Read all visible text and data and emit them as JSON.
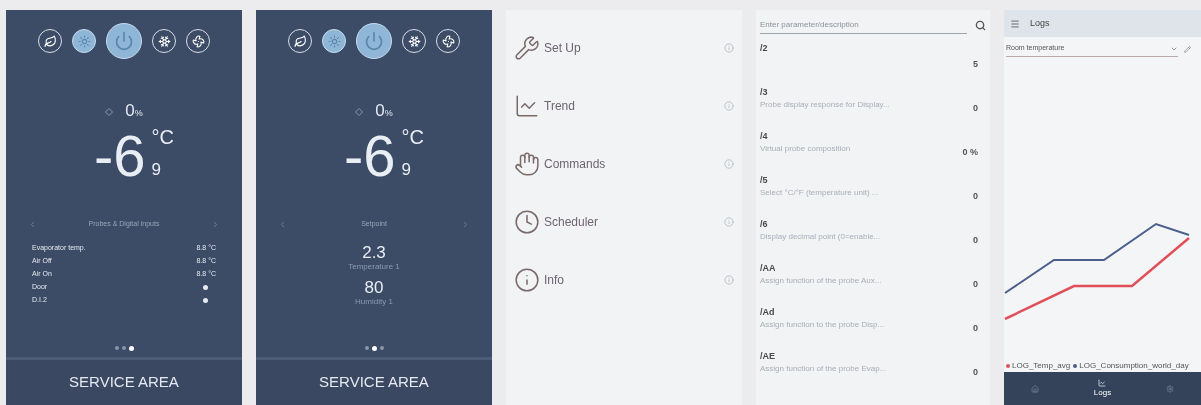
{
  "panels": [
    {
      "kind": "thermostat",
      "mode_icons": [
        {
          "kind": "leaf",
          "selected": false
        },
        {
          "kind": "light",
          "selected": true
        },
        {
          "kind": "power",
          "selected": true
        },
        {
          "kind": "defrost",
          "selected": false
        },
        {
          "kind": "fan",
          "selected": false
        }
      ],
      "humidity": {
        "value": "0",
        "unit": "%"
      },
      "temperature": {
        "value": "-6",
        "unit": "°C",
        "decimal": "9"
      },
      "section_title": "Probes & Digital inputs",
      "readings": [
        {
          "label": "Evaporator temp.",
          "value": "8.8 °C",
          "kind": "text"
        },
        {
          "label": "Air Off",
          "value": "8.8 °C",
          "kind": "text"
        },
        {
          "label": "Air On",
          "value": "8.8 °C",
          "kind": "text"
        },
        {
          "label": "Door",
          "kind": "dot"
        },
        {
          "label": "D.I.2",
          "kind": "dot"
        }
      ],
      "page_dots": [
        {
          "selected": false
        },
        {
          "selected": false
        },
        {
          "selected": true
        }
      ],
      "footer_button": "SERVICE AREA"
    },
    {
      "kind": "thermostat",
      "mode_icons": [
        {
          "kind": "leaf",
          "selected": false
        },
        {
          "kind": "light",
          "selected": true
        },
        {
          "kind": "power",
          "selected": true
        },
        {
          "kind": "defrost",
          "selected": false
        },
        {
          "kind": "fan",
          "selected": false
        }
      ],
      "humidity": {
        "value": "0",
        "unit": "%"
      },
      "temperature": {
        "value": "-6",
        "unit": "°C",
        "decimal": "9"
      },
      "section_title": "Setpoint",
      "setpoints": [
        {
          "value": "2.3",
          "caption": "Temperature 1"
        },
        {
          "value": "80",
          "caption": "Humidity 1"
        }
      ],
      "page_dots": [
        {
          "selected": false
        },
        {
          "selected": true
        },
        {
          "selected": false
        }
      ],
      "footer_button": "SERVICE AREA"
    },
    {
      "kind": "menu",
      "items": [
        {
          "label": "Set Up"
        },
        {
          "label": "Trend"
        },
        {
          "label": "Commands"
        },
        {
          "label": "Scheduler"
        },
        {
          "label": "Info"
        }
      ]
    },
    {
      "kind": "parameters",
      "search": {
        "placeholder": "Enter parameter/description"
      },
      "rows": [
        {
          "code": "/2",
          "value": "5"
        },
        {
          "code": "/3",
          "description": "Probe display response for Display...",
          "value": "0"
        },
        {
          "code": "/4",
          "description": "Virtual probe composition",
          "value": "0 %"
        },
        {
          "code": "/5",
          "description": "Select °C/°F (temperature unit) ...",
          "value": "0"
        },
        {
          "code": "/6",
          "description": "Display decimal point (0=enable...",
          "value": "0"
        },
        {
          "code": "/AA",
          "description": "Assign function of the probe Aux...",
          "value": "0"
        },
        {
          "code": "/Ad",
          "description": "Assign function to the probe Disp...",
          "value": "0"
        },
        {
          "code": "/AE",
          "description": "Assign function of the probe Evap...",
          "value": "0"
        }
      ]
    },
    {
      "kind": "logs",
      "title": "Logs",
      "selector": "Room temperature",
      "legend": [
        {
          "label": "LOG_Temp_avg",
          "color": "#e0505a"
        },
        {
          "label": "LOG_Consumption_world_day",
          "color": "#4a5f8a"
        }
      ],
      "nav": [
        {
          "selected": false
        },
        {
          "label": "Logs",
          "selected": true
        },
        {
          "selected": false
        }
      ]
    }
  ]
}
